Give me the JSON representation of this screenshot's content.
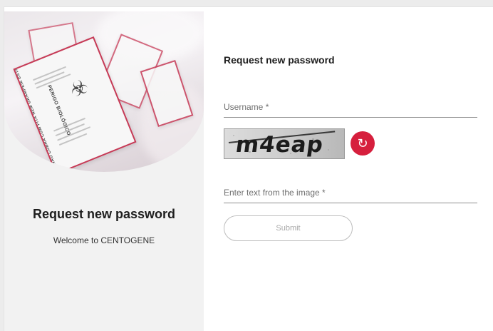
{
  "left": {
    "title": "Request new password",
    "subtitle": "Welcome to CENTOGENE"
  },
  "form": {
    "title": "Request new password",
    "username_placeholder": "Username *",
    "captcha_text": "m4eap",
    "captcha_input_placeholder": "Enter text from the image *",
    "submit_label": "Submit"
  },
  "hero": {
    "warning_text": "PERIGO BIOLÓGICO",
    "disposal_text": "NÃO CUBRA COM FITA NEM GRAMPEIE ESTA ÁREA"
  },
  "colors": {
    "accent": "#d61f3d",
    "card_border": "#c63a56",
    "left_panel_bg": "#f2f2f2",
    "page_bg": "#ececec"
  },
  "icons": {
    "refresh": "refresh-icon",
    "biohazard": "biohazard-icon"
  }
}
